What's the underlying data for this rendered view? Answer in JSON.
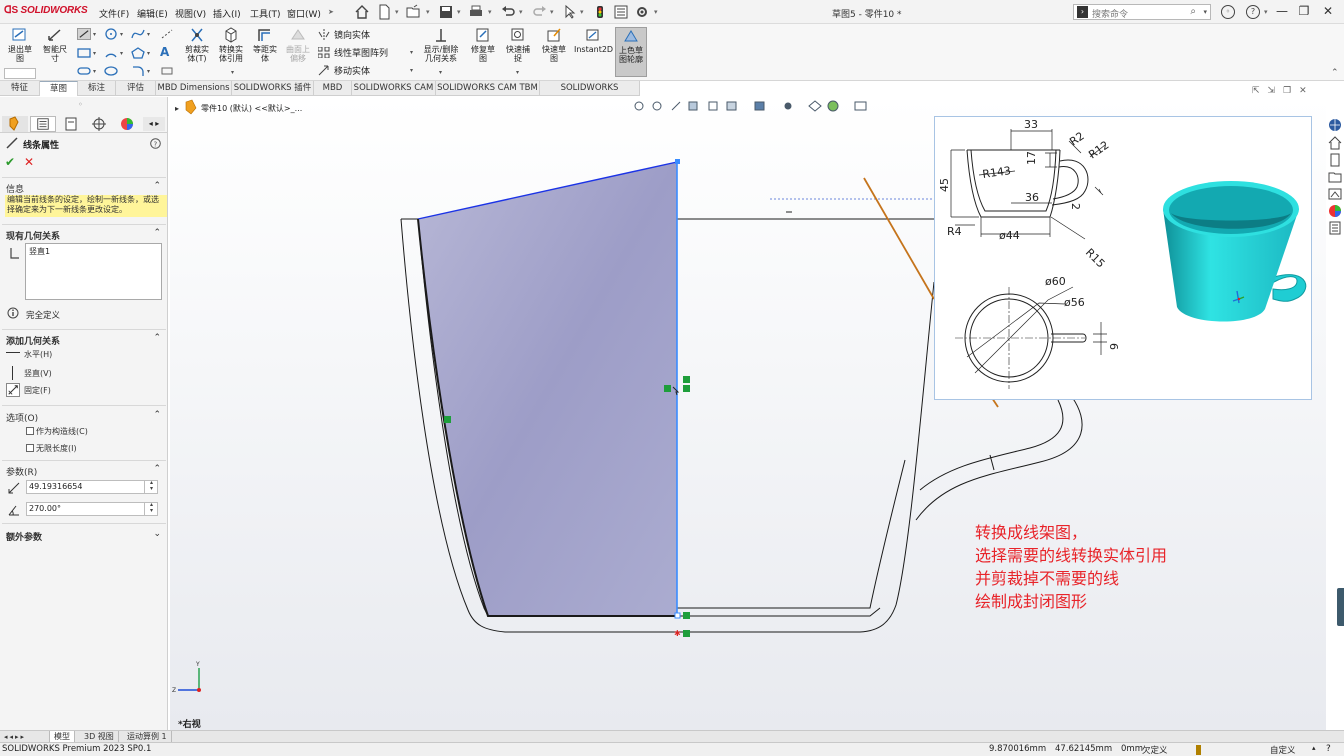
{
  "app": {
    "logo": "SOLIDWORKS",
    "doc_title": "草图5 - 零件10 *",
    "search_placeholder": "搜索命令"
  },
  "menu": [
    "文件(F)",
    "编辑(E)",
    "视图(V)",
    "插入(I)",
    "工具(T)",
    "窗口(W)"
  ],
  "ribbon": {
    "exit_sketch": "退出草\n图",
    "smart_dim": "智能尺\n寸",
    "trim": "剪裁实\n体(T)",
    "convert": "转换实\n体引用",
    "offset": "等距实\n体",
    "surface_offset": "曲面上\n偏移",
    "mirror": "镜向实体",
    "linear_pattern": "线性草图阵列",
    "move": "移动实体",
    "show_relations": "显示/删除\n几何关系",
    "repair": "修复草\n图",
    "quick_snap": "快速捕\n捉",
    "rapid_sketch": "快速草\n图",
    "instant2d": "Instant2D",
    "shaded_contours": "上色草\n图轮廓"
  },
  "tabs": [
    "特征",
    "草图",
    "标注",
    "评估",
    "MBD Dimensions",
    "SOLIDWORKS 插件",
    "MBD",
    "SOLIDWORKS CAM",
    "SOLIDWORKS CAM TBM",
    "SOLIDWORKS Inspection"
  ],
  "active_tab": "草图",
  "tree_breadcrumb": "零件10 (默认) <<默认>_...",
  "panel": {
    "title": "线条属性",
    "info_header": "信息",
    "info_text": "编辑当前线条的设定，绘制一新线条，或选择确定来为下一新线条更改设定。",
    "existing_header": "现有几何关系",
    "existing_item": "竖直1",
    "status": "完全定义",
    "add_header": "添加几何关系",
    "add_items": [
      "水平(H)",
      "竖直(V)",
      "固定(F)"
    ],
    "options_header": "选项(O)",
    "option_construction": "作为构造线(C)",
    "option_infinite": "无限长度(I)",
    "params_header": "参数(R)",
    "length": "49.19316654",
    "angle": "270.00°",
    "extra_header": "额外参数"
  },
  "view_label": "*右视",
  "triad": {
    "x": "Z",
    "y": "Y"
  },
  "ref_drawing": {
    "dims": [
      "33",
      "R2",
      "R12",
      "17",
      "R143",
      "45",
      "36",
      "2",
      "R4",
      "ø44",
      "R15",
      "ø60",
      "ø56",
      "6"
    ]
  },
  "annotation": [
    "转换成线架图，",
    "选择需要的线转换实体引用",
    "并剪裁掉不需要的线",
    "绘制成封闭图形"
  ],
  "bottom_tabs": [
    "模型",
    "3D 视图",
    "运动算例 1"
  ],
  "status": {
    "product": "SOLIDWORKS Premium 2023 SP0.1",
    "x": "9.870016mm",
    "y": "47.62145mm",
    "z": "0mm",
    "state": "欠定义",
    "units": "自定义"
  },
  "colors": {
    "sketch_fill": "#9d9dc7",
    "sketch_line": "#1b33e6",
    "annotation": "#e8242a",
    "cup": "#2fe3e3"
  }
}
